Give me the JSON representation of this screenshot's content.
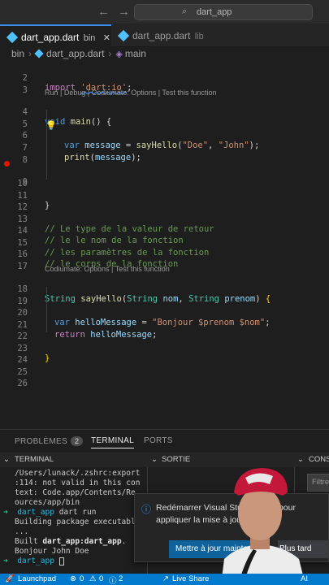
{
  "titlebar": {
    "back_icon": "←",
    "forward_icon": "→",
    "search_text": "dart_app"
  },
  "tabs": [
    {
      "name": "dart_app.dart",
      "desc": "bin",
      "active": true,
      "close": "✕"
    },
    {
      "name": "dart_app.dart",
      "desc": "lib",
      "active": false
    }
  ],
  "breadcrumb": {
    "folder": "bin",
    "file": "dart_app.dart",
    "symbol": "main",
    "sep": "›"
  },
  "editor": {
    "line_numbers": [
      "2",
      "3",
      "4",
      "5",
      "6",
      "7",
      "8",
      "9",
      "10",
      "11",
      "12",
      "13",
      "14",
      "15",
      "16",
      "17",
      "18",
      "19",
      "20",
      "21",
      "22",
      "23",
      "24",
      "25",
      "26"
    ],
    "import_kw": "import",
    "import_str": "'dart:io'",
    "semicolon": ";",
    "lens_main": "Run | Debug | Codiumate: Options | Test this function",
    "void_kw": "void",
    "main_fn": "main",
    "paren_open_brace": "() {",
    "var_kw": "var",
    "message_var": "message",
    "eq": " = ",
    "sayhello_fn": "sayHello",
    "open_paren": "(",
    "doe_str": "\"Doe\"",
    "comma": ", ",
    "john_str": "\"John\"",
    "close_paren_semi": ");",
    "print_fn": "print",
    "close_brace": "}",
    "comment1": "// Le type de la valeur de retour",
    "comment2": "// le le nom de la fonction",
    "comment3": "// les paramètres de la fonction",
    "comment4": "// le corps de la fonction",
    "lens_sayhello": "Codiumate: Options | Test this function",
    "string_ty": "String",
    "nom_param": "nom",
    "prenom_param": "prenom",
    "brace_open": "{",
    "hellomessage_var": "helloMessage",
    "hello_str": "\"Bonjour $prenom $nom\"",
    "return_kw": "return",
    "bulb_icon": "💡"
  },
  "panel": {
    "tabs": [
      "PROBLÈMES",
      "TERMINAL",
      "PORTS"
    ],
    "problems_count": "2",
    "sub_headers": [
      "TERMINAL",
      "SORTIE",
      "CONS"
    ],
    "filter_placeholder": "Filtre",
    "terminal_lines": [
      "/Users/lunack/.zshrc:export",
      ":114: not valid in this con",
      "text: Code.app/Contents/Re",
      "ources/app/bin"
    ],
    "prompt_arrow": "➜",
    "prompt_dir": "dart_app",
    "cmd": "dart run",
    "out1": "Building package executabl",
    "out2": "...",
    "built_prefix": "Built ",
    "built_name": "dart_app:dart_app",
    "built_suffix": ".",
    "out_hello": "Bonjour John Doe"
  },
  "notification": {
    "icon": "ⓘ",
    "message": "Redémarrer Visual Studio Code pour appliquer la mise à jour.",
    "primary_button": "Mettre à jour maintenant",
    "secondary_button": "Plus tard"
  },
  "statusbar": {
    "launchpad": "Launchpad",
    "errors": "0",
    "warnings": "0",
    "info": "2",
    "live_share": "Live Share",
    "ai": "AI"
  },
  "colors": {
    "accent": "#007acc",
    "editor_bg": "#1e1e1e",
    "primary_button": "#0e639c"
  }
}
